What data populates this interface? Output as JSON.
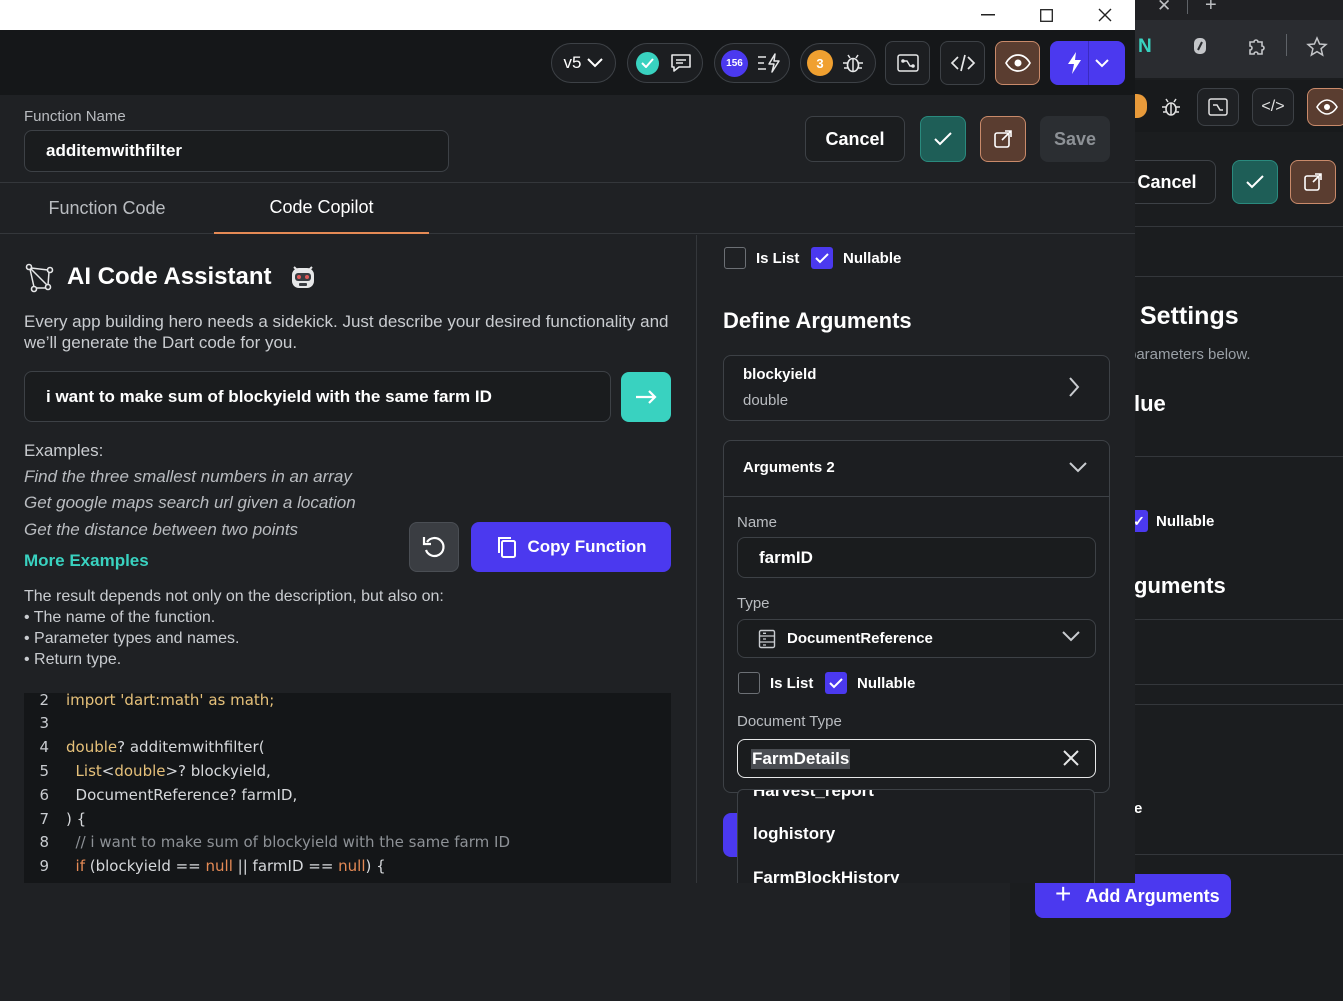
{
  "window": {
    "minimize": "—",
    "maximize": "☐",
    "close": "✕"
  },
  "toolbar": {
    "version": "v5",
    "badge_count": "156",
    "bug_count": "3"
  },
  "function_header": {
    "name_label": "Function Name",
    "name_value": "additemwithfilter",
    "cancel_label": "Cancel",
    "save_label": "Save"
  },
  "tabs": [
    {
      "label": "Function Code",
      "active": false
    },
    {
      "label": "Code Copilot",
      "active": true
    }
  ],
  "assistant": {
    "title": "AI Code Assistant",
    "description": "Every app building hero needs a sidekick. Just describe your desired functionality and we’ll generate the Dart code for you.",
    "prompt_value": "i want to make sum of blockyield with the same farm ID",
    "examples_label": "Examples:",
    "examples": [
      "Find the three smallest numbers in an array",
      "Get google maps search url given a location",
      "Get the distance between two points"
    ],
    "more_examples": "More Examples",
    "copy_label": "Copy Function",
    "result_note": [
      "The result depends not only on the description, but also on:",
      "• The name of the function.",
      "• Parameter types and names.",
      "• Return type."
    ]
  },
  "code": {
    "line_numbers": [
      "2",
      "3",
      "4",
      "5",
      "6",
      "7",
      "8",
      "9"
    ],
    "line2": "import 'dart:math' as math;",
    "line4_type": "double",
    "line4_rest": "? additemwithfilter(",
    "line5_type": "List",
    "line5_lt": "<",
    "line5_inner": "double",
    "line5_rest": ">? blockyield,",
    "line6": "DocumentReference? farmID,",
    "line7": ") {",
    "line8": "// i want to make sum of blockyield with the same farm ID",
    "line9_a": "if",
    "line9_b": " (blockyield == ",
    "line9_c": "null",
    "line9_d": " || farmID == ",
    "line9_e": "null",
    "line9_f": ") {"
  },
  "arguments_panel": {
    "top_is_list": "Is List",
    "top_nullable": "Nullable",
    "define_title": "Define Arguments",
    "arg1_name": "blockyield",
    "arg1_type": "double",
    "arg2_title": "Arguments 2",
    "name_label": "Name",
    "name_value": "farmID",
    "type_label": "Type",
    "type_value": "DocumentReference",
    "is_list": "Is List",
    "nullable": "Nullable",
    "doc_type_label": "Document Type",
    "doc_type_value": "FarmDetails",
    "dropdown_options": [
      "Harvest_report",
      "loghistory",
      "FarmBlockHistory"
    ]
  },
  "background_window": {
    "cancel_label": "Cancel",
    "settings_title": "Settings",
    "params_hint": "parameters below.",
    "value_title": "lue",
    "nullable": "Nullable",
    "arguments_title": "guments",
    "e_label": "e",
    "add_arguments": "Add Arguments"
  },
  "colors": {
    "accent_primary": "#4b39ef",
    "accent_teal": "#39d2c0",
    "accent_orange": "#e58a55",
    "background": "#1f2124"
  }
}
